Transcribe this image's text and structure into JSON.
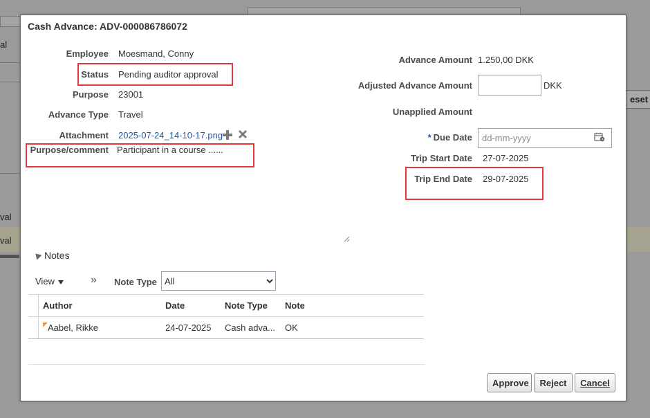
{
  "background": {
    "tab_left_fragment": "al",
    "reset_fragment": "eset",
    "row_fragment_1": "val",
    "row_fragment_2": "val"
  },
  "dialog": {
    "title": "Cash Advance: ADV-000086786072",
    "left_fields": {
      "employee_label": "Employee",
      "employee_value": "Moesmand, Conny",
      "status_label": "Status",
      "status_value": "Pending auditor approval",
      "purpose_label": "Purpose",
      "purpose_value": "23001",
      "advance_type_label": "Advance Type",
      "advance_type_value": "Travel",
      "attachment_label": "Attachment",
      "attachment_value": "2025-07-24_14-10-17.png",
      "purpose_comment_label": "Purpose/comment",
      "purpose_comment_value": "Participant in a course ......"
    },
    "right_fields": {
      "advance_amount_label": "Advance Amount",
      "advance_amount_value": "1.250,00 DKK",
      "adjusted_advance_amount_label": "Adjusted Advance Amount",
      "adjusted_advance_amount_value": "",
      "adjusted_currency": "DKK",
      "unapplied_amount_label": "Unapplied Amount",
      "due_date_required": "*",
      "due_date_label": "Due Date",
      "due_date_placeholder": "dd-mm-yyyy",
      "trip_start_date_label": "Trip Start Date",
      "trip_start_date_value": "27-07-2025",
      "trip_end_date_label": "Trip End Date",
      "trip_end_date_value": "29-07-2025"
    },
    "notes": {
      "section_title": "Notes",
      "view_label": "View",
      "more_chevron": "»",
      "note_type_label": "Note Type",
      "note_type_selected": "All",
      "columns": [
        "Author",
        "Date",
        "Note Type",
        "Note"
      ],
      "rows": [
        {
          "author": "Aabel, Rikke",
          "date": "24-07-2025",
          "note_type": "Cash adva...",
          "note": "OK"
        }
      ]
    },
    "buttons": {
      "approve": "Approve",
      "reject": "Reject",
      "cancel": "Cancel"
    }
  },
  "colors": {
    "highlight_border": "#e0393e",
    "link": "#1f56a5",
    "overlay": "#8f8f8f"
  }
}
